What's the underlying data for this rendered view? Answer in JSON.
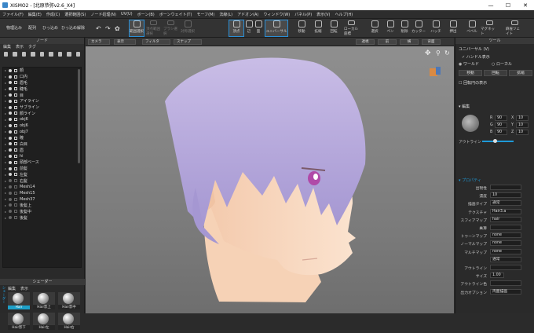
{
  "window": {
    "title": "XISMO2 - [北原恭弥v2.6_X4]",
    "min": "—",
    "max": "☐",
    "close": "✕"
  },
  "menu": [
    "ファイル(F)",
    "編集(E)",
    "作成(C)",
    "選択範囲(S)",
    "ノード処理(N)",
    "UV(U)",
    "ボーン(B)",
    "ボーンウェイト(T)",
    "モーフ(M)",
    "法線(L)",
    "アドオン(A)",
    "ウィンドウ(W)",
    "パネル(P)",
    "表示(V)",
    "ヘルプ(H)"
  ],
  "toolbar": {
    "left_texts": [
      "物理込み",
      "配列",
      "ひっ込め",
      "ひっ込め解除"
    ],
    "buttons": [
      {
        "label": "範囲選択",
        "icon": "box-select-icon",
        "state": "active"
      },
      {
        "label": "頂点範囲選択",
        "icon": "vertex-select-icon",
        "state": "dim"
      },
      {
        "label": "ブラシ選択",
        "icon": "brush-select-icon",
        "state": "dim"
      },
      {
        "label": "対称選択",
        "icon": "symmetry-icon",
        "state": "dim"
      },
      {
        "label": "頂点",
        "icon": "vertex-icon",
        "state": "active"
      },
      {
        "label": "辺",
        "icon": "edge-icon",
        "state": ""
      },
      {
        "label": "面",
        "icon": "face-icon",
        "state": ""
      },
      {
        "label": "ユニバーサル",
        "icon": "universal-icon",
        "state": "active"
      },
      {
        "label": "移動",
        "icon": "move-icon",
        "state": ""
      },
      {
        "label": "拡縮",
        "icon": "scale-icon",
        "state": ""
      },
      {
        "label": "回転",
        "icon": "rotate-icon",
        "state": ""
      },
      {
        "label": "ローカル座標",
        "icon": "local-icon",
        "state": ""
      },
      {
        "label": "選択",
        "icon": "select-icon",
        "state": ""
      },
      {
        "label": "ペン",
        "icon": "pen-icon",
        "state": ""
      },
      {
        "label": "削除",
        "icon": "delete-icon",
        "state": ""
      },
      {
        "label": "カッター",
        "icon": "cutter-icon",
        "state": ""
      },
      {
        "label": "ハッチ",
        "icon": "hatch-icon",
        "state": ""
      },
      {
        "label": "押出",
        "icon": "extrude-icon",
        "state": ""
      },
      {
        "label": "ベベル",
        "icon": "bevel-icon",
        "state": ""
      },
      {
        "label": "マグネット",
        "icon": "magnet-icon",
        "state": ""
      },
      {
        "label": "麻雀ツェイト",
        "icon": "hair-icon",
        "state": ""
      }
    ]
  },
  "nodes": {
    "panel_title": "ノード",
    "tabs": [
      "編集",
      "表示",
      "タグ"
    ],
    "items": [
      "顔",
      "口内",
      "眉毛",
      "睫毛",
      "目",
      "アイライン",
      "サブライン",
      "顔ライン",
      "obj6",
      "obj6",
      "obj7",
      "瞳",
      "白目",
      "眉",
      "hi",
      "頭部ベース",
      "前髪",
      "左髪",
      "右髪",
      "Mesh14",
      "Mesh15",
      "Mesh37",
      "後髪上",
      "後髪中",
      "後髪"
    ]
  },
  "viewport": {
    "buttons": [
      "カメラ",
      "表示",
      "フィルタ",
      "スナップ"
    ],
    "view_tabs": [
      "透視",
      "前",
      "横",
      "背面"
    ]
  },
  "shader": {
    "panel_title": "シェーダー",
    "tabs": [
      "編集",
      "表示"
    ],
    "side_label": "シェーダー",
    "items": [
      "Hair",
      "Hair影上",
      "Hair影中",
      "Hair影下",
      "Hair左",
      "Hair右"
    ]
  },
  "tool_panel": {
    "title": "ツール",
    "universal": "ユニバーサル (V)",
    "handle": "ハンドル表示",
    "world": "ワールド",
    "local": "ローカル",
    "btns": [
      "移動",
      "回転",
      "拡縮"
    ],
    "rot_circle": "回転円の表示"
  },
  "edit_panel": {
    "title": "編集",
    "R": "90",
    "G": "90",
    "B": "90",
    "X": "10",
    "Y": "10",
    "Z": "10",
    "outline_label": "アウトライン"
  },
  "property": {
    "title": "プロパティ",
    "rows": [
      {
        "label": "出現性",
        "value": ""
      },
      {
        "label": "濃度",
        "value": "10"
      },
      {
        "label": "描画タイプ",
        "value": "通常"
      },
      {
        "label": "テクスチャ",
        "value": "Hair3.a"
      },
      {
        "label": "スフィアマップ",
        "value": "hair"
      },
      {
        "label": "乗算",
        "value": ""
      },
      {
        "label": "トゥーンマップ",
        "value": "none"
      },
      {
        "label": "ノーマルマップ",
        "value": "none"
      },
      {
        "label": "マルチマップ",
        "value": "none"
      },
      {
        "label": "",
        "value": "通常"
      },
      {
        "label": "アウトライン",
        "value": ""
      },
      {
        "label": "サイズ",
        "value": "1.00"
      },
      {
        "label": "アウトライン色",
        "value": ""
      },
      {
        "label": "出力オプション",
        "value": "両面描画"
      }
    ]
  }
}
